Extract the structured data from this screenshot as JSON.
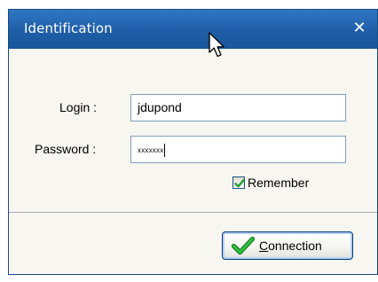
{
  "window": {
    "title": "Identification",
    "close_glyph": "✕",
    "close_icon": "close-icon"
  },
  "form": {
    "login_label": "Login :",
    "login_value": "jdupond",
    "password_label": "Password :",
    "password_value": "xxxxxxx",
    "remember_label": "Remember",
    "remember_checked": true
  },
  "actions": {
    "connect_mnemonic": "C",
    "connect_rest": "onnection",
    "connect_icon": "green-checkmark-icon"
  },
  "colors": {
    "titlebar": "#2566b0",
    "check_green": "#1ea12f",
    "background": "#f7f6f1"
  }
}
